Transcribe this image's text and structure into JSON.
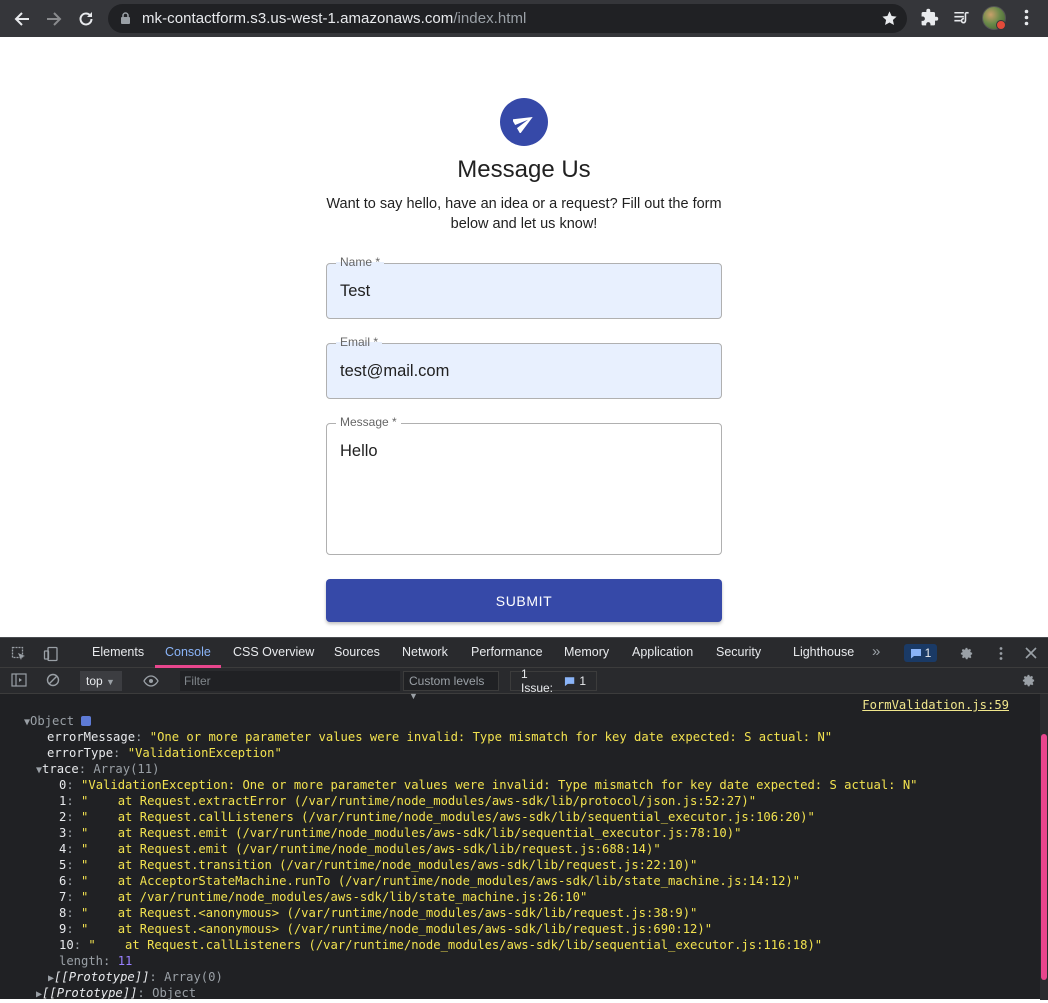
{
  "browser": {
    "url_host": "mk-contactform.s3.us-west-1.amazonaws.com",
    "url_path": "/index.html"
  },
  "page": {
    "title": "Message Us",
    "subtitle": "Want to say hello, have an idea or a request? Fill out the form below and let us know!",
    "name_label": "Name *",
    "name_value": "Test",
    "email_label": "Email *",
    "email_value": "test@mail.com",
    "message_label": "Message *",
    "message_value": "Hello",
    "submit_label": "SUBMIT",
    "accent_color": "#3649a8"
  },
  "devtools": {
    "tabs": [
      "Elements",
      "Console",
      "CSS Overview",
      "Sources",
      "Network",
      "Performance",
      "Memory",
      "Application",
      "Security",
      "Lighthouse"
    ],
    "active_tab": "Console",
    "issue_count": "1",
    "context": "top",
    "filter_placeholder": "Filter",
    "levels": "Custom levels",
    "issues_label": "1 Issue:",
    "issues_count": "1",
    "accent_color": "#e8468d"
  },
  "console": {
    "source": "FormValidation.js:59",
    "object_label": "Object",
    "error_message_key": "errorMessage",
    "error_message": "\"One or more parameter values were invalid: Type mismatch for key date expected: S actual: N\"",
    "error_type_key": "errorType",
    "error_type": "\"ValidationException\"",
    "trace_key": "trace",
    "trace_type": "Array(11)",
    "trace": [
      "\"ValidationException: One or more parameter values were invalid: Type mismatch for key date expected: S actual: N\"",
      "\"    at Request.extractError (/var/runtime/node_modules/aws-sdk/lib/protocol/json.js:52:27)\"",
      "\"    at Request.callListeners (/var/runtime/node_modules/aws-sdk/lib/sequential_executor.js:106:20)\"",
      "\"    at Request.emit (/var/runtime/node_modules/aws-sdk/lib/sequential_executor.js:78:10)\"",
      "\"    at Request.emit (/var/runtime/node_modules/aws-sdk/lib/request.js:688:14)\"",
      "\"    at Request.transition (/var/runtime/node_modules/aws-sdk/lib/request.js:22:10)\"",
      "\"    at AcceptorStateMachine.runTo (/var/runtime/node_modules/aws-sdk/lib/state_machine.js:14:12)\"",
      "\"    at /var/runtime/node_modules/aws-sdk/lib/state_machine.js:26:10\"",
      "\"    at Request.<anonymous> (/var/runtime/node_modules/aws-sdk/lib/request.js:38:9)\"",
      "\"    at Request.<anonymous> (/var/runtime/node_modules/aws-sdk/lib/request.js:690:12)\"",
      "\"    at Request.callListeners (/var/runtime/node_modules/aws-sdk/lib/sequential_executor.js:116:18)\""
    ],
    "length_key": "length",
    "length_value": "11",
    "array_proto_key": "[[Prototype]]",
    "array_proto_value": "Array(0)",
    "object_proto_key": "[[Prototype]]",
    "object_proto_value": "Object"
  }
}
